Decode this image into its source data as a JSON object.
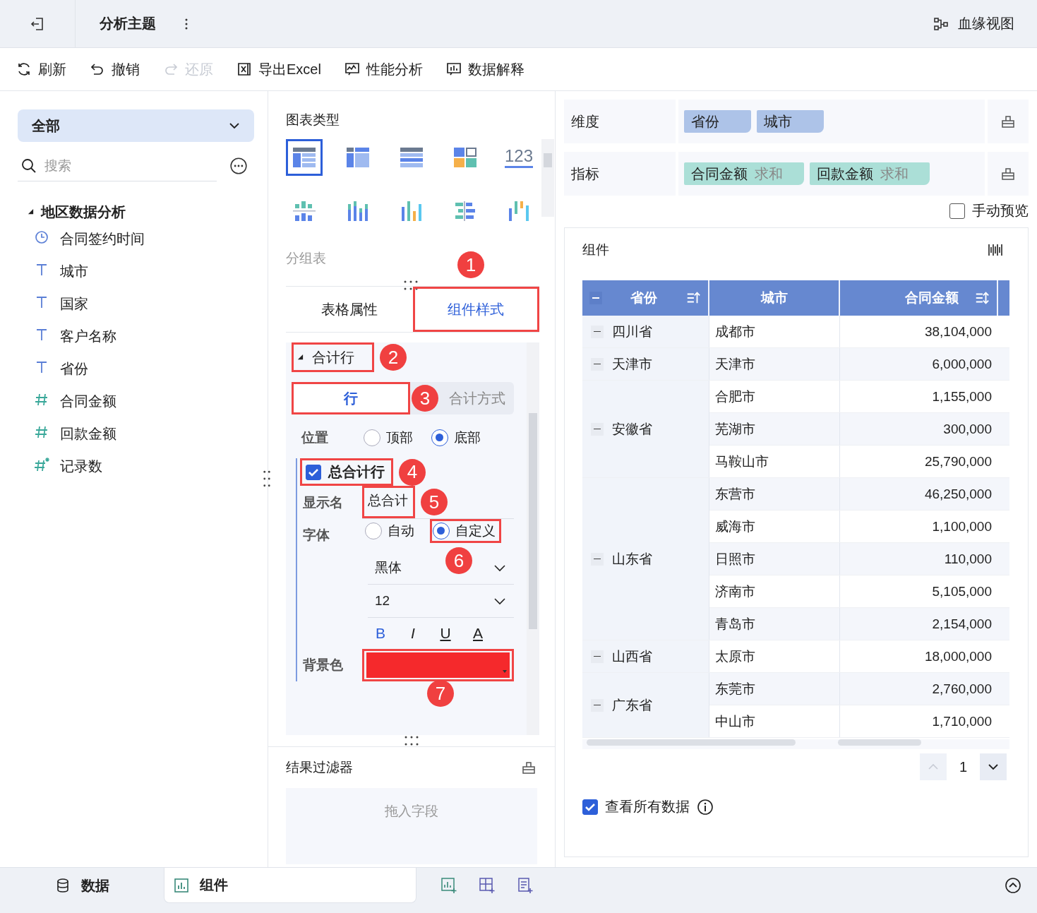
{
  "header": {
    "title": "分析主题",
    "lineage": "血缘视图"
  },
  "toolbar": [
    {
      "label": "刷新",
      "disabled": false
    },
    {
      "label": "撤销",
      "disabled": false
    },
    {
      "label": "还原",
      "disabled": true
    },
    {
      "label": "导出Excel",
      "disabled": false
    },
    {
      "label": "性能分析",
      "disabled": false
    },
    {
      "label": "数据解释",
      "disabled": false
    }
  ],
  "left": {
    "dropdown": "全部",
    "search": {
      "placeholder": "搜索"
    },
    "tree": {
      "label": "地区数据分析",
      "expanded": true,
      "children": [
        {
          "label": "合同签约时间",
          "kind": "time"
        },
        {
          "label": "城市",
          "kind": "text"
        },
        {
          "label": "国家",
          "kind": "text"
        },
        {
          "label": "客户名称",
          "kind": "text"
        },
        {
          "label": "省份",
          "kind": "text"
        },
        {
          "label": "合同金额",
          "kind": "number"
        },
        {
          "label": "回款金额",
          "kind": "number"
        },
        {
          "label": "记录数",
          "kind": "count"
        }
      ]
    }
  },
  "middle": {
    "chart_types_title": "图表类型",
    "chart_types": [
      {
        "kind": "group-table",
        "selected": true
      },
      {
        "kind": "cross-table",
        "selected": false
      },
      {
        "kind": "detail-table",
        "selected": false
      },
      {
        "kind": "tiles",
        "selected": false
      },
      {
        "kind": "number",
        "text": "123",
        "selected": false
      },
      {
        "kind": "stacked-split",
        "selected": false
      },
      {
        "kind": "stacked-bars",
        "selected": false
      },
      {
        "kind": "multi-bars",
        "selected": false
      },
      {
        "kind": "mirror-bars",
        "selected": false
      },
      {
        "kind": "range-bars",
        "selected": false
      }
    ],
    "chart_type_name": "分组表",
    "tabs": [
      {
        "label": "表格属性",
        "selected": false
      },
      {
        "label": "组件样式",
        "selected": true,
        "callout": "1"
      }
    ],
    "total_row": {
      "title": "合计行",
      "expanded": true,
      "callout": "2",
      "subtabs": [
        {
          "label": "行",
          "selected": true,
          "callout": "3"
        },
        {
          "label": "合计方式",
          "selected": false
        }
      ],
      "position": {
        "label": "位置",
        "options": [
          {
            "label": "顶部",
            "selected": false
          },
          {
            "label": "底部",
            "selected": true
          }
        ]
      },
      "grand_total": {
        "label": "总合计行",
        "checked": true,
        "callout": "4"
      },
      "display_name": {
        "label": "显示名",
        "value": "总合计",
        "callout": "5"
      },
      "font": {
        "label": "字体",
        "options": [
          {
            "label": "自动",
            "selected": false
          },
          {
            "label": "自定义",
            "selected": true,
            "callout": "6"
          }
        ],
        "family": "黑体",
        "size": "12",
        "styles": [
          {
            "kind": "bold",
            "label": "B",
            "selected": true
          },
          {
            "kind": "italic",
            "label": "I",
            "selected": false
          },
          {
            "kind": "underline",
            "label": "U",
            "selected": false
          },
          {
            "kind": "color",
            "label": "A",
            "selected": false
          }
        ]
      },
      "background": {
        "label": "背景色",
        "color": "#f5292c",
        "callout": "7"
      }
    },
    "filter": {
      "title": "结果过滤器",
      "placeholder": "拖入字段"
    }
  },
  "right": {
    "dimension": {
      "label": "维度",
      "fields": [
        "省份",
        "城市"
      ]
    },
    "measure": {
      "label": "指标",
      "fields": [
        {
          "name": "合同金额",
          "agg": "求和"
        },
        {
          "name": "回款金额",
          "agg": "求和"
        }
      ]
    },
    "manual_preview": {
      "label": "手动预览",
      "checked": false
    },
    "component": {
      "title": "组件",
      "columns": [
        {
          "label": "省份",
          "sortable": true,
          "ascending": true
        },
        {
          "label": "城市",
          "sortable": false
        },
        {
          "label": "合同金额",
          "sortable": true,
          "ascending": false
        }
      ],
      "groups": [
        {
          "province": "四川省",
          "rows": [
            [
              "成都市",
              "38,104,000"
            ]
          ]
        },
        {
          "province": "天津市",
          "rows": [
            [
              "天津市",
              "6,000,000"
            ]
          ]
        },
        {
          "province": "安徽省",
          "rows": [
            [
              "合肥市",
              "1,155,000"
            ],
            [
              "芜湖市",
              "300,000"
            ],
            [
              "马鞍山市",
              "25,790,000"
            ]
          ]
        },
        {
          "province": "山东省",
          "rows": [
            [
              "东营市",
              "46,250,000"
            ],
            [
              "威海市",
              "1,100,000"
            ],
            [
              "日照市",
              "110,000"
            ],
            [
              "济南市",
              "5,105,000"
            ],
            [
              "青岛市",
              "2,154,000"
            ]
          ]
        },
        {
          "province": "山西省",
          "rows": [
            [
              "太原市",
              "18,000,000"
            ]
          ]
        },
        {
          "province": "广东省",
          "rows": [
            [
              "东莞市",
              "2,760,000"
            ],
            [
              "中山市",
              "1,710,000"
            ]
          ]
        }
      ],
      "page": "1"
    },
    "view_all": {
      "label": "查看所有数据",
      "checked": true
    }
  },
  "bottom": {
    "tabs": [
      {
        "label": "数据",
        "selected": false
      },
      {
        "label": "组件",
        "selected": true
      }
    ]
  }
}
